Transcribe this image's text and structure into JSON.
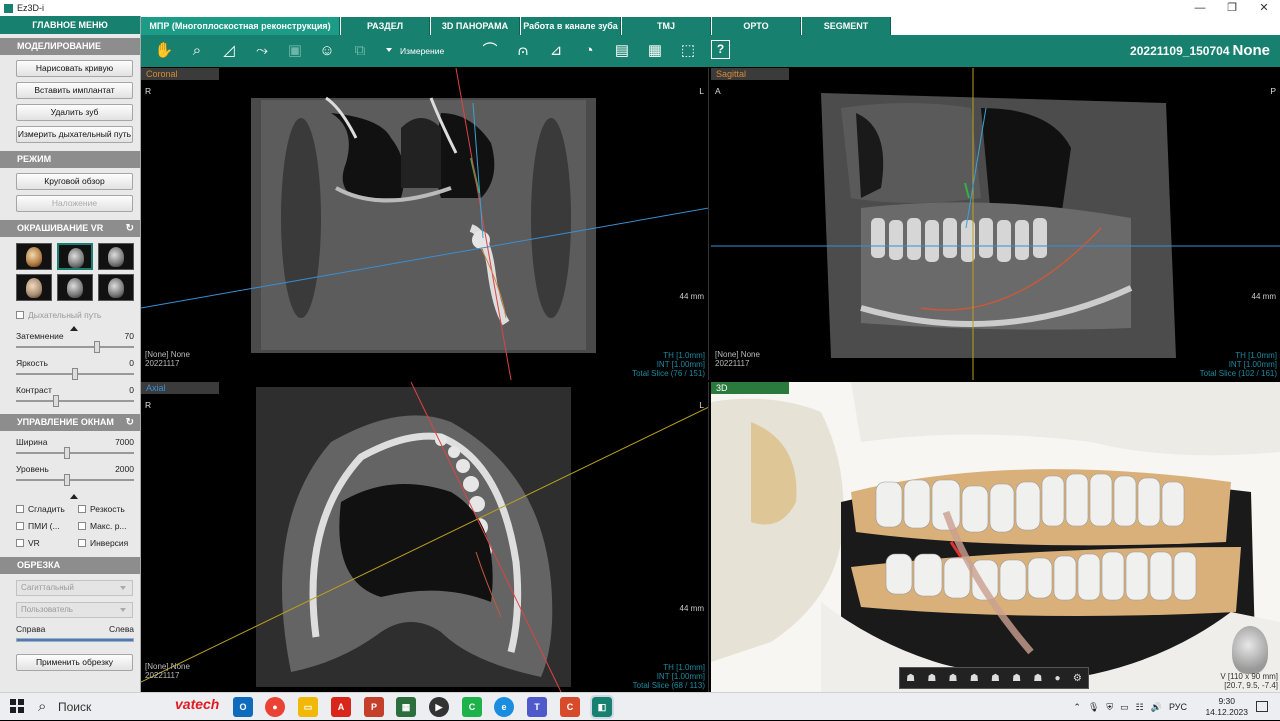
{
  "window": {
    "title": "Ez3D-i",
    "controls": [
      "—",
      "❐",
      "✕"
    ]
  },
  "sidebar": {
    "main_menu": "ГЛАВНОЕ МЕНЮ",
    "modeling": {
      "title": "МОДЕЛИРОВАНИЕ",
      "buttons": [
        "Нарисовать кривую",
        "Вставить имплантат",
        "Удалить зуб",
        "Измерить дыхательный путь"
      ]
    },
    "mode": {
      "title": "РЕЖИМ",
      "buttons": [
        "Круговой обзор",
        "Наложение"
      ]
    },
    "vr_coloring": {
      "title": "ОКРАШИВАНИЕ VR",
      "airway_checkbox": "Дыхательный путь"
    },
    "sliders": [
      {
        "label": "Затемнение",
        "value": "70",
        "level_fraction": 0.7
      },
      {
        "label": "Яркость",
        "value": "0",
        "level_fraction": 0.5
      },
      {
        "label": "Контраст",
        "value": "0",
        "level_fraction": 0.33
      }
    ],
    "window_control": {
      "title": "УПРАВЛЕНИЕ ОКНАМ",
      "sliders": [
        {
          "label": "Ширина",
          "value": "7000",
          "level_fraction": 0.43
        },
        {
          "label": "Уровень",
          "value": "2000",
          "level_fraction": 0.43
        }
      ],
      "checkboxes": [
        "Сгладить",
        "Резкость",
        "ПМИ (...",
        "Макс. р...",
        "VR",
        "Инверсия"
      ]
    },
    "crop": {
      "title": "ОБРЕЗКА",
      "dropdown1": "Сагиттальный",
      "dropdown2": "Пользователь",
      "right_label": "Справа",
      "left_label": "Слева",
      "apply_button": "Применить обрезку"
    }
  },
  "tabs": [
    "МПР (Многоплоскостная реконструкция)",
    "РАЗДЕЛ",
    "3D ПАНОРАМА",
    "Работа в канале зуба",
    "TMJ",
    "ОРТО",
    "SEGMENT"
  ],
  "toolbar": {
    "measure_label": "Измерение",
    "help": "?",
    "study_id": "20221109_150704",
    "patient": "None"
  },
  "viewports": {
    "coronal": {
      "tag": "Coronal",
      "left": "R",
      "right": "L",
      "info": [
        "[None] None",
        "20221117"
      ],
      "scale": "44 mm",
      "status": [
        "TH [1.0mm]",
        "INT [1.00mm]",
        "Total Slice (76 / 151)"
      ]
    },
    "sagittal": {
      "tag": "Sagittal",
      "left": "A",
      "right": "P",
      "info": [
        "[None] None",
        "20221117"
      ],
      "scale": "44 mm",
      "status": [
        "TH [1.0mm]",
        "INT [1.00mm]",
        "Total Slice (102 / 161)"
      ]
    },
    "axial": {
      "tag": "Axial",
      "left": "R",
      "right": "L",
      "info": [
        "[None] None",
        "20221117"
      ],
      "scale": "44 mm",
      "status": [
        "TH [1.0mm]",
        "INT [1.00mm]",
        "Total Slice (68 / 113)"
      ]
    },
    "v3d": {
      "tag": "3D",
      "dims": [
        "V [110 x 90 mm]",
        "[20.7, 9.5, -7.4]"
      ]
    }
  },
  "taskbar": {
    "search": "Поиск",
    "vendor": "vatech",
    "lang": "РУС",
    "time": "9:30",
    "date": "14.12.2023"
  }
}
